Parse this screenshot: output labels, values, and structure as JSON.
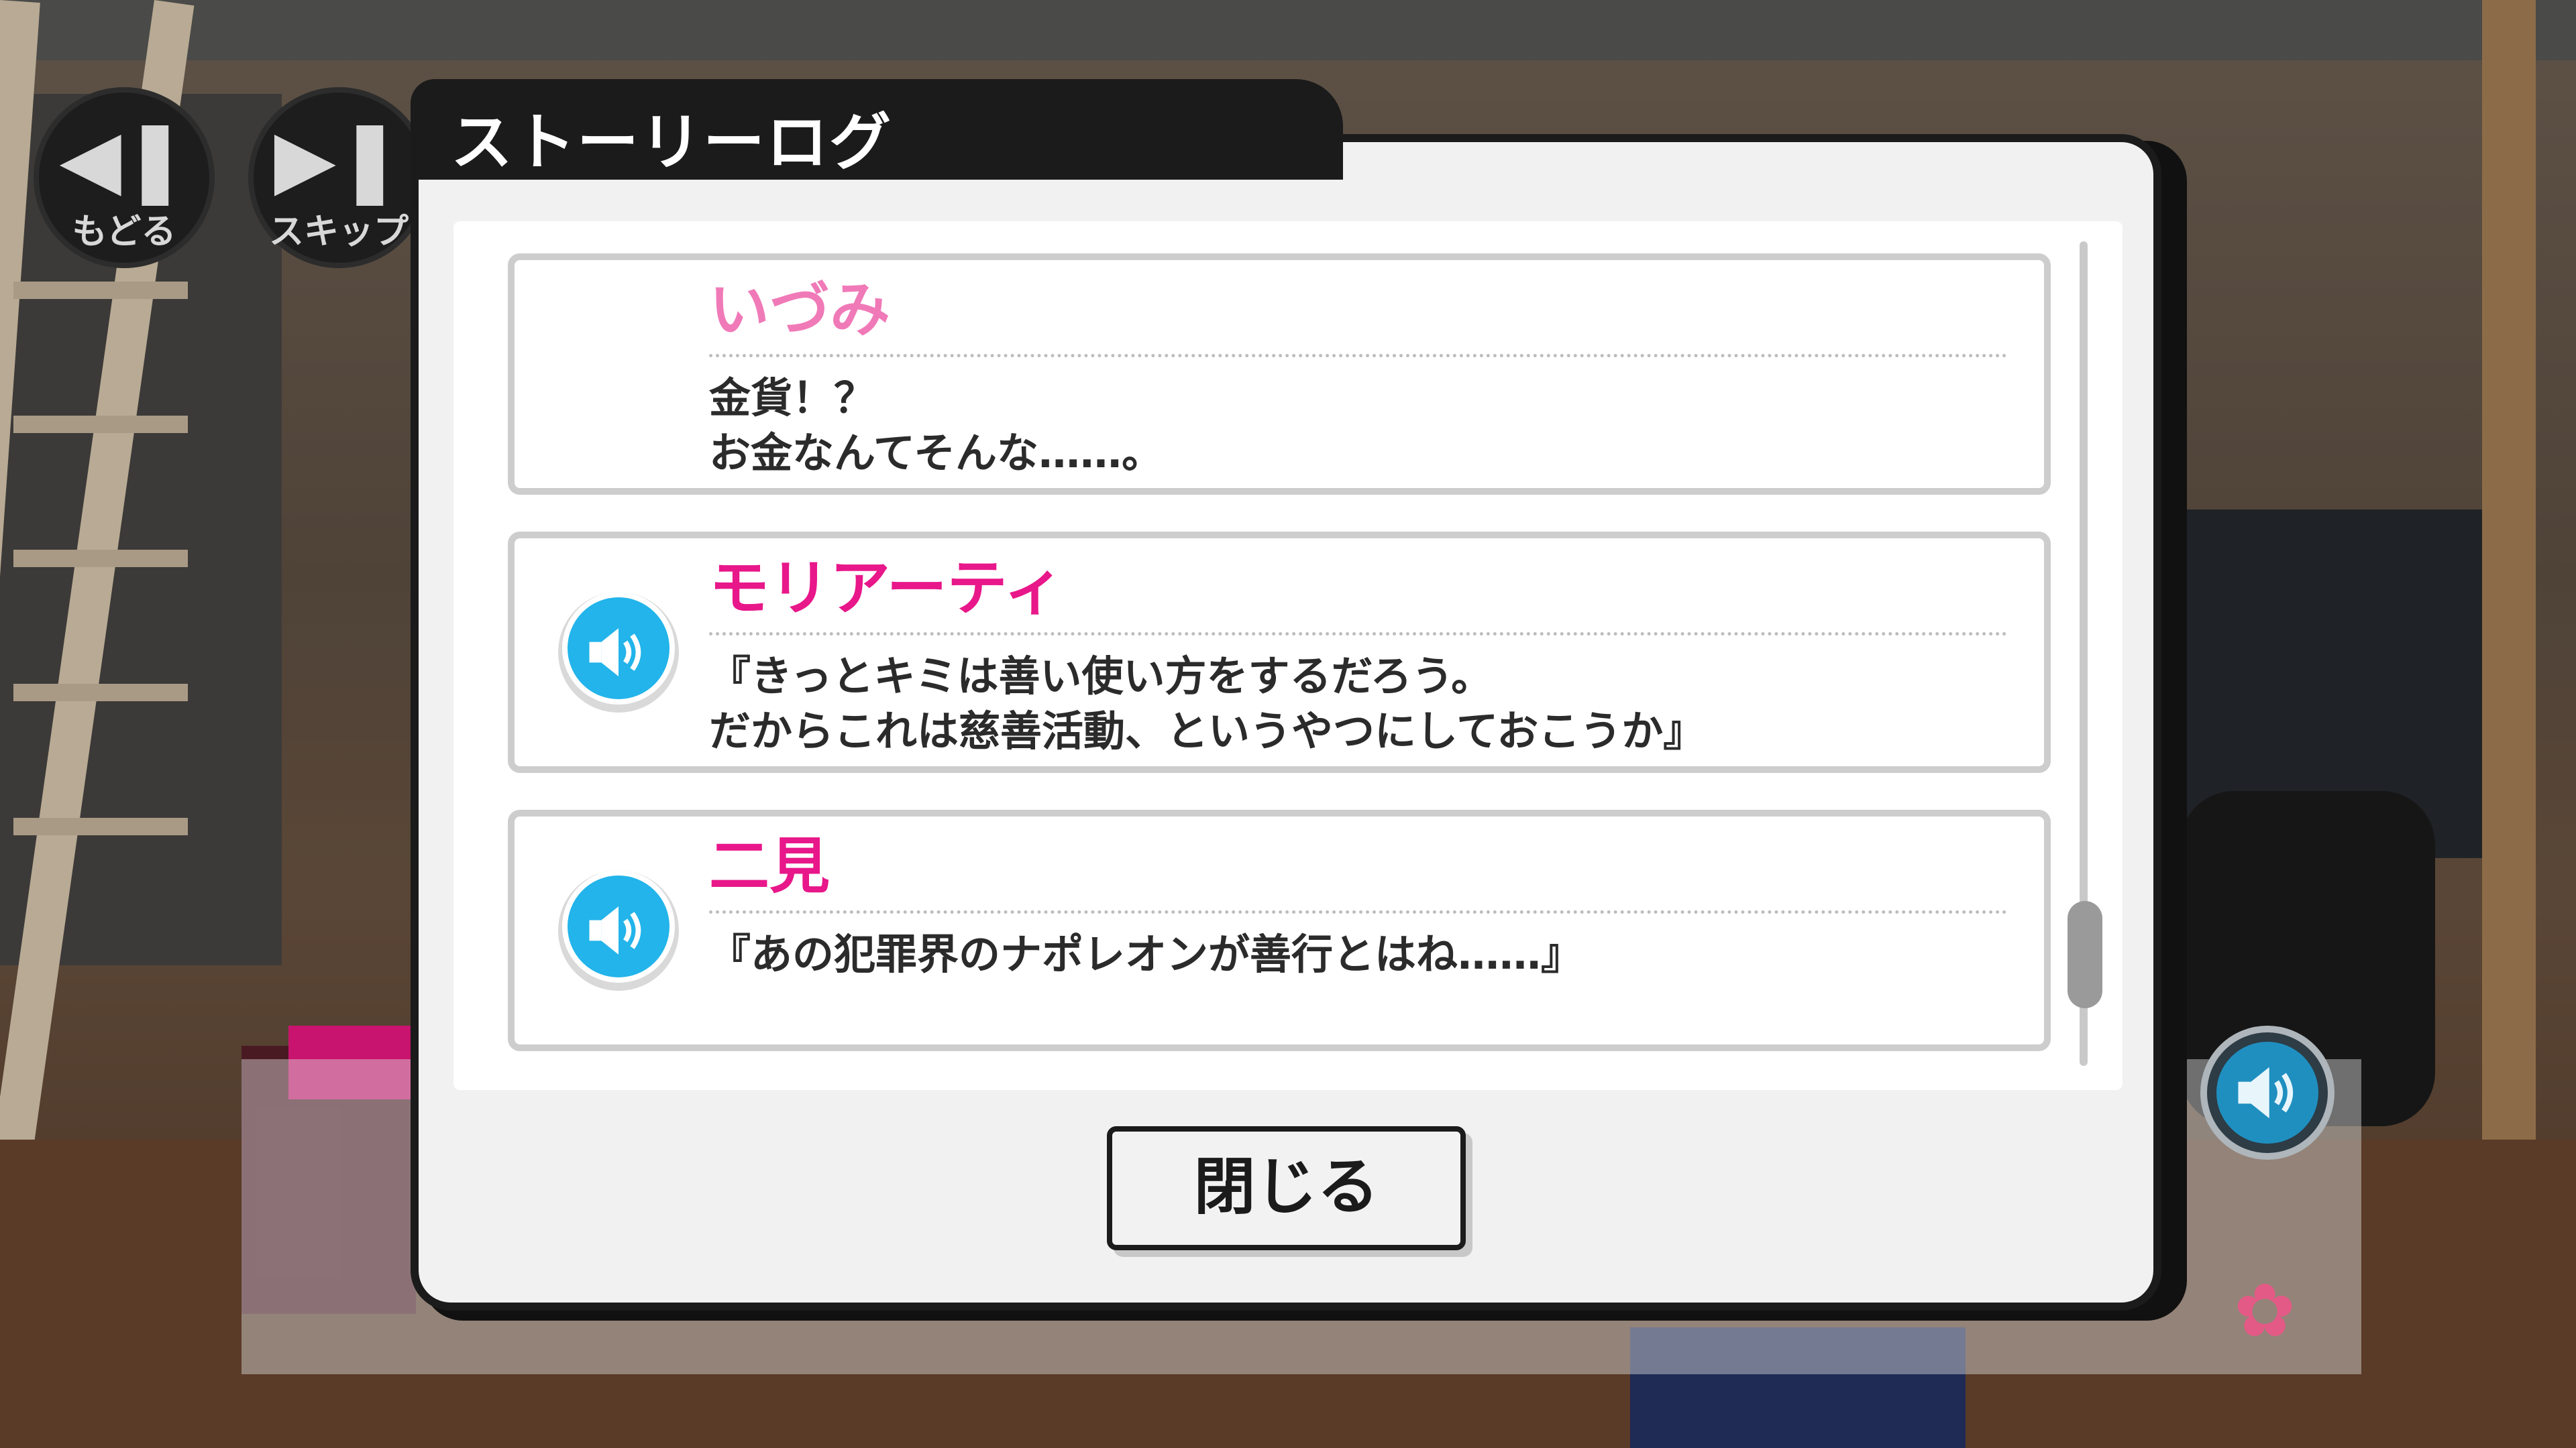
{
  "controls": {
    "back_label": "もどる",
    "skip_label": "スキップ",
    "back_icon": "rewind-icon",
    "skip_icon": "skip-icon"
  },
  "dialog": {
    "title": "ストーリーログ",
    "close_label": "閉じる"
  },
  "entries": [
    {
      "speaker": "いづみ",
      "speaker_color": "#f07ab8",
      "has_voice": false,
      "text": "金貨！？\nお金なんてそんな……。"
    },
    {
      "speaker": "モリアーティ",
      "speaker_color": "#e8178a",
      "has_voice": true,
      "text": "『きっとキミは善い使い方をするだろう。\nだからこれは慈善活動、というやつにしておこうか』"
    },
    {
      "speaker": "二見",
      "speaker_color": "#e8178a",
      "has_voice": true,
      "text": "『あの犯罪界のナポレオンが善行とはね……』"
    }
  ],
  "scroll": {
    "position_fraction": 0.92,
    "visible_fraction": 0.13
  },
  "colors": {
    "voice_button": "#22b4ea",
    "dialog_border": "#1b1b1b",
    "dialog_bg": "#f1f1f1"
  },
  "icons": {
    "voice": "speaker-icon",
    "flower": "flower-icon"
  }
}
